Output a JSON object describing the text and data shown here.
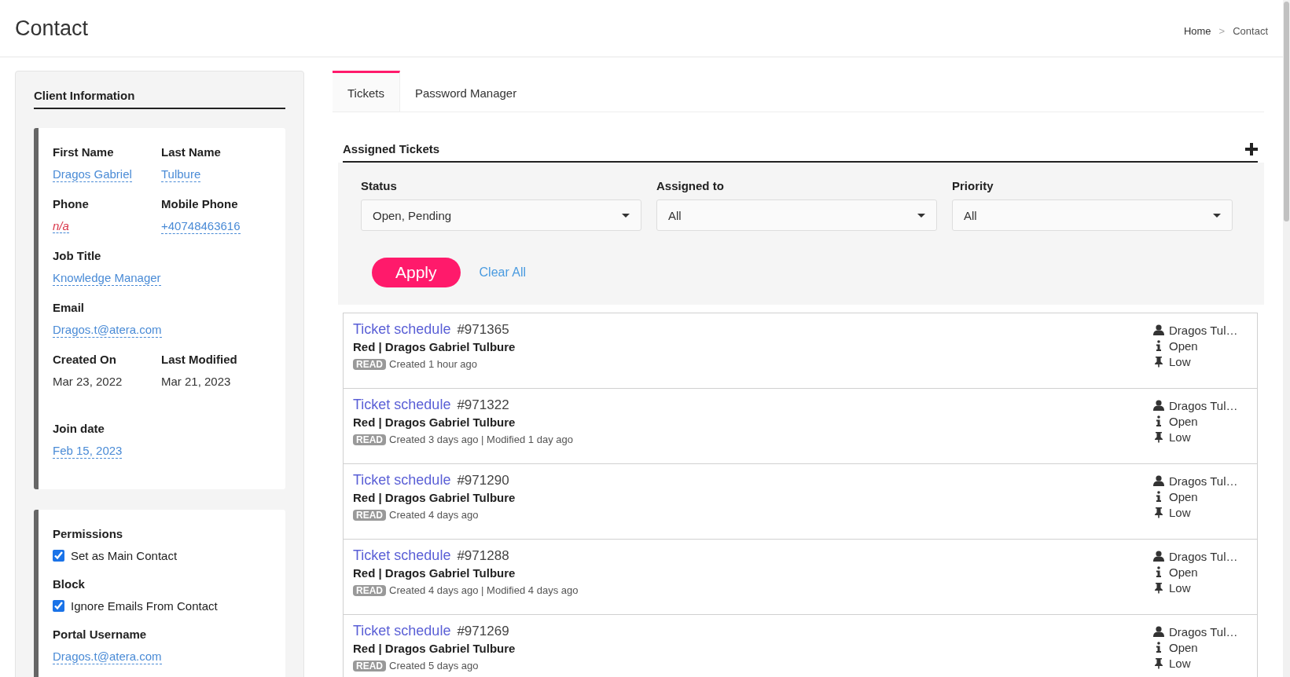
{
  "page": {
    "title": "Contact"
  },
  "breadcrumb_separator": ">",
  "breadcrumb": [
    {
      "label": "Home",
      "kind": "link"
    },
    {
      "label": "Contact",
      "kind": "current"
    }
  ],
  "client_info": {
    "title": "Client Information",
    "cards": [
      {
        "rows": [
          [
            {
              "label": "First Name",
              "value": "Dragos Gabriel",
              "kind": "link"
            },
            {
              "label": "Last Name",
              "value": "Tulbure",
              "kind": "link"
            }
          ],
          [
            {
              "label": "Phone",
              "value": "n/a",
              "kind": "empty"
            },
            {
              "label": "Mobile Phone",
              "value": "+40748463616",
              "kind": "link"
            }
          ],
          [
            {
              "label": "Job Title",
              "value": "Knowledge Manager",
              "kind": "link"
            }
          ],
          [
            {
              "label": "Email",
              "value": "Dragos.t@atera.com",
              "kind": "link"
            }
          ],
          [
            {
              "label": "Created On",
              "value": "Mar 23, 2022",
              "kind": "plain"
            },
            {
              "label": "Last Modified",
              "value": "Mar 21, 2023",
              "kind": "plain"
            }
          ],
          [
            {
              "label": "Join date",
              "value": "Feb 15, 2023",
              "kind": "link"
            }
          ]
        ]
      },
      {
        "rows": [
          [
            {
              "label": "Permissions",
              "kind": "checkbox",
              "option": "Set as Main Contact",
              "checked": true
            }
          ],
          [
            {
              "label": "Block",
              "kind": "checkbox",
              "option": "Ignore Emails From Contact",
              "checked": true
            }
          ],
          [
            {
              "label": "Portal Username",
              "value": "Dragos.t@atera.com",
              "kind": "link"
            }
          ]
        ]
      }
    ]
  },
  "tabs": [
    {
      "label": "Tickets",
      "selected": true
    },
    {
      "label": "Password Manager",
      "selected": false
    }
  ],
  "assigned_tickets": {
    "title": "Assigned Tickets",
    "filters": [
      {
        "label": "Status",
        "value": "Open, Pending"
      },
      {
        "label": "Assigned to",
        "value": "All"
      },
      {
        "label": "Priority",
        "value": "All"
      }
    ],
    "apply_button": "Apply",
    "clear_link": "Clear All",
    "tickets": [
      {
        "title": "Ticket schedule",
        "number": "#971365",
        "subtitle": "Red | Dragos Gabriel Tulbure",
        "badge": "READ",
        "meta": "Created 1 hour ago",
        "assignee": "Dragos Tul…",
        "status": "Open",
        "priority": "Low"
      },
      {
        "title": "Ticket schedule",
        "number": "#971322",
        "subtitle": "Red | Dragos Gabriel Tulbure",
        "badge": "READ",
        "meta": "Created 3 days ago | Modified 1 day ago",
        "assignee": "Dragos Tul…",
        "status": "Open",
        "priority": "Low"
      },
      {
        "title": "Ticket schedule",
        "number": "#971290",
        "subtitle": "Red | Dragos Gabriel Tulbure",
        "badge": "READ",
        "meta": "Created 4 days ago",
        "assignee": "Dragos Tul…",
        "status": "Open",
        "priority": "Low"
      },
      {
        "title": "Ticket schedule",
        "number": "#971288",
        "subtitle": "Red | Dragos Gabriel Tulbure",
        "badge": "READ",
        "meta": "Created 4 days ago | Modified 4 days ago",
        "assignee": "Dragos Tul…",
        "status": "Open",
        "priority": "Low"
      },
      {
        "title": "Ticket schedule",
        "number": "#971269",
        "subtitle": "Red | Dragos Gabriel Tulbure",
        "badge": "READ",
        "meta": "Created 5 days ago",
        "assignee": "Dragos Tul…",
        "status": "Open",
        "priority": "Low"
      }
    ]
  }
}
